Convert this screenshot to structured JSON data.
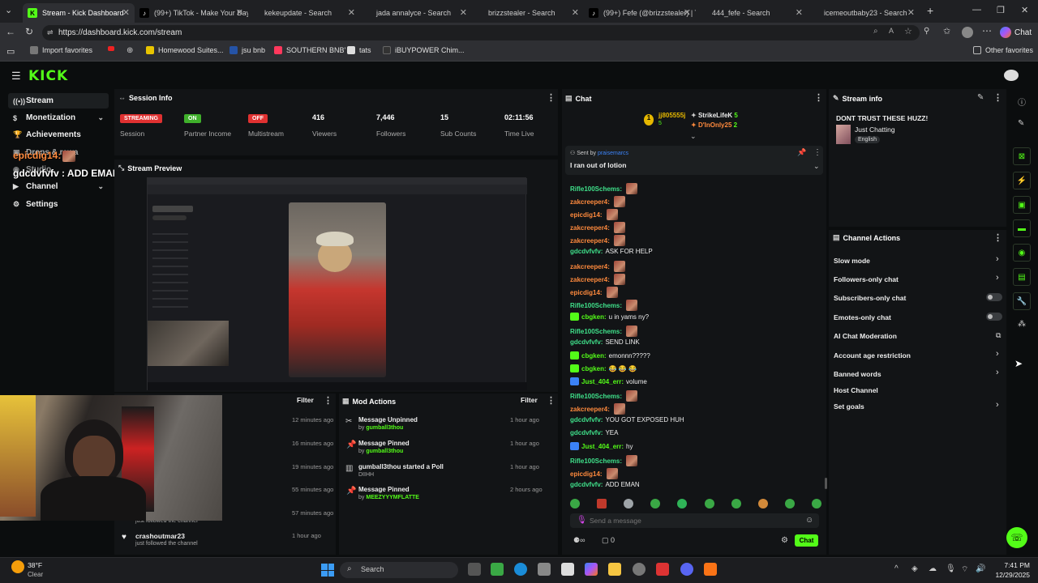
{
  "browser": {
    "tabs": [
      {
        "title": "Stream - Kick Dashboard",
        "active": true
      },
      {
        "title": "(99+) TikTok - Make Your Day"
      },
      {
        "title": "kekeupdate - Search"
      },
      {
        "title": "jada annalyce - Search"
      },
      {
        "title": "brizzstealer - Search"
      },
      {
        "title": "(99+) Fefe (@brizzstealer) | T"
      },
      {
        "title": "444_fefe - Search"
      },
      {
        "title": "icemeoutbaby23 - Search"
      }
    ],
    "url": "https://dashboard.kick.com/stream",
    "chat_button": "Chat",
    "favorites": [
      "Import favorites",
      "Homewood Suites...",
      "jsu bnb",
      "SOUTHERN BNB'",
      "tats",
      "iBUYPOWER Chim...",
      "Other favorites"
    ]
  },
  "logo": "KICK",
  "sidebar": {
    "items": [
      {
        "label": "Stream",
        "icon": "broadcast-icon",
        "active": true
      },
      {
        "label": "Monetization",
        "icon": "dollar-icon",
        "chevron": true
      },
      {
        "label": "Achievements",
        "icon": "trophy-icon"
      },
      {
        "label": "Drops & rewa",
        "icon": "gift-icon"
      },
      {
        "label": "Studio",
        "icon": "studio-icon"
      },
      {
        "label": "Channel",
        "icon": "channel-icon",
        "chevron": true
      },
      {
        "label": "Settings",
        "icon": "gear-icon",
        "chevron": true
      }
    ],
    "overlay_1": "epicdig14:",
    "overlay_2": "gdcdvfvfv : ADD EMAN"
  },
  "session": {
    "title": "Session Info",
    "stats": [
      {
        "badge": "STREAMING",
        "label": "Session",
        "color": "#e03131"
      },
      {
        "badge": "ON",
        "label": "Partner Income",
        "color": "#3fb02b"
      },
      {
        "badge": "OFF",
        "label": "Multistream",
        "color": "#e03131"
      },
      {
        "value": "416",
        "label": "Viewers"
      },
      {
        "value": "7,446",
        "label": "Followers"
      },
      {
        "value": "15",
        "label": "Sub Counts"
      },
      {
        "value": "02:11:56",
        "label": "Time Live"
      }
    ]
  },
  "preview": {
    "title": "Stream Preview"
  },
  "activity": {
    "filter": "Filter",
    "times": [
      "12 minutes ago",
      "16 minutes ago",
      "19 minutes ago",
      "55 minutes ago",
      "57 minutes ago"
    ],
    "partial_sub": "just followed the channel",
    "last": {
      "user": "crashoutmar23",
      "sub": "just followed the channel",
      "time": "1 hour ago"
    }
  },
  "mod_actions": {
    "title": "Mod Actions",
    "filter": "Filter",
    "items": [
      {
        "title": "Message Unpinned",
        "by": "by",
        "user": "gumball3thou",
        "time": "1 hour ago"
      },
      {
        "title": "Message Pinned",
        "by": "by",
        "user": "gumball3thou",
        "time": "1 hour ago"
      },
      {
        "title": "gumball3thou started a Poll",
        "sub": "DIIHH",
        "time": "1 hour ago"
      },
      {
        "title": "Message Pinned",
        "by": "by",
        "user": "MEEZYYYMFLATTE",
        "time": "2 hours ago"
      }
    ]
  },
  "chat": {
    "title": "Chat",
    "top_gifters": [
      {
        "name": "jj805555j",
        "count": "5"
      },
      {
        "name": "StrikeLifeK",
        "count": "5"
      },
      {
        "name": "D'InOnly25",
        "count": "2"
      }
    ],
    "pinned": {
      "sent_by_label": "Sent by",
      "sender": "praisemarcs",
      "text": "I ran out of lotion"
    },
    "messages": [
      {
        "user": "Rifle100Schems:",
        "color": "#3fe08a",
        "text": "",
        "emote": true
      },
      {
        "user": "zakcreeper4:",
        "color": "#ff8a3d",
        "text": "",
        "emote": true
      },
      {
        "user": "epicdig14:",
        "color": "#ff8a3d",
        "text": "",
        "emote": true
      },
      {
        "user": "zakcreeper4:",
        "color": "#ff8a3d",
        "text": "",
        "emote": true
      },
      {
        "user": "zakcreeper4:",
        "color": "#ff8a3d",
        "text": "",
        "emote": true
      },
      {
        "user": "gdcdvfvfv:",
        "color": "#3fe08a",
        "text": "ASK FOR HELP"
      },
      {
        "user": "zakcreeper4:",
        "color": "#ff8a3d",
        "text": "",
        "emote": true
      },
      {
        "user": "zakcreeper4:",
        "color": "#ff8a3d",
        "text": "",
        "emote": true
      },
      {
        "user": "epicdig14:",
        "color": "#ff8a3d",
        "text": "",
        "emote": true
      },
      {
        "user": "Rifle100Schems:",
        "color": "#3fe08a",
        "text": "",
        "emote": true
      },
      {
        "user": "cbgken:",
        "color": "#53fc18",
        "text": "u in yams ny?",
        "badge": true
      },
      {
        "user": "Rifle100Schems:",
        "color": "#3fe08a",
        "text": "",
        "emote": true
      },
      {
        "user": "gdcdvfvfv:",
        "color": "#3fe08a",
        "text": "SEND LINK"
      },
      {
        "user": "cbgken:",
        "color": "#53fc18",
        "text": "emonnn?????",
        "badge": true
      },
      {
        "user": "cbgken:",
        "color": "#53fc18",
        "text": "😂 😂 😂",
        "badge": true
      },
      {
        "user": "Just_404_err:",
        "color": "#53fc18",
        "text": "volume",
        "badge": true
      },
      {
        "user": "Rifle100Schems:",
        "color": "#3fe08a",
        "text": "",
        "emote": true
      },
      {
        "user": "zakcreeper4:",
        "color": "#ff8a3d",
        "text": "",
        "emote": true
      },
      {
        "user": "gdcdvfvfv:",
        "color": "#3fe08a",
        "text": "YOU GOT EXPOSED HUH"
      },
      {
        "user": "gdcdvfvfv:",
        "color": "#3fe08a",
        "text": "YEA"
      },
      {
        "user": "Just_404_err:",
        "color": "#53fc18",
        "text": "hy",
        "badge": true
      },
      {
        "user": "Rifle100Schems:",
        "color": "#3fe08a",
        "text": "",
        "emote": true
      },
      {
        "user": "epicdig14:",
        "color": "#ff8a3d",
        "text": "",
        "emote": true
      },
      {
        "user": "gdcdvfvfv:",
        "color": "#3fe08a",
        "text": "ADD EMAN"
      }
    ],
    "input_placeholder": "Send a message",
    "points": "0",
    "send_label": "Chat"
  },
  "stream_info": {
    "title": "Stream info",
    "stream_title": "DONT TRUST THESE HUZZ!",
    "category": "Just Chatting",
    "language": "English"
  },
  "channel_actions": {
    "title": "Channel Actions",
    "items": [
      {
        "label": "Slow mode",
        "control": "arrow"
      },
      {
        "label": "Followers-only chat",
        "control": "arrow"
      },
      {
        "label": "Subscribers-only chat",
        "control": "toggle"
      },
      {
        "label": "Emotes-only chat",
        "control": "toggle"
      },
      {
        "label": "AI Chat Moderation",
        "control": "external"
      },
      {
        "label": "Account age restriction",
        "control": "arrow"
      },
      {
        "label": "Banned words",
        "control": "arrow"
      },
      {
        "label": "Host Channel",
        "control": "none"
      },
      {
        "label": "Set goals",
        "control": "arrow"
      }
    ]
  },
  "taskbar": {
    "weather_temp": "38°F",
    "weather_desc": "Clear",
    "search": "Search",
    "time": "7:41 PM",
    "date": "12/29/2025"
  }
}
